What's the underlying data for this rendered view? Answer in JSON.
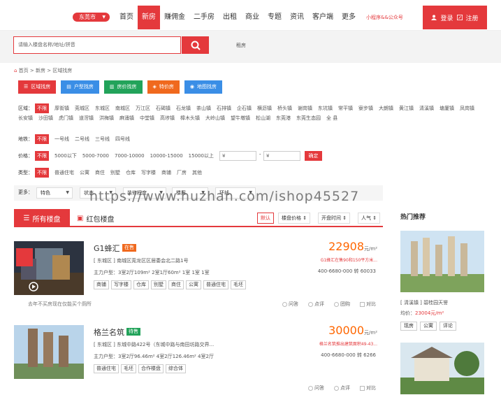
{
  "header": {
    "city": "东莞市",
    "nav": [
      "首页",
      "新房",
      "赚佣金",
      "二手房",
      "出租",
      "商业",
      "专题",
      "资讯",
      "客户端",
      "更多"
    ],
    "active_nav": 1,
    "mini_program": "小程序&&公众号",
    "login": "登录",
    "register": "注册"
  },
  "search": {
    "placeholder": "请输入楼盘名称/地址/拼音",
    "rent": "租房"
  },
  "breadcrumb": "首页 > 新房 > 区域找房",
  "find_tabs": [
    {
      "label": "区域找房",
      "color": "#e4393c"
    },
    {
      "label": "户型找房",
      "color": "#3a8ee6"
    },
    {
      "label": "房价找房",
      "color": "#22a35a"
    },
    {
      "label": "特价房",
      "color": "#f0691e"
    },
    {
      "label": "地图找房",
      "color": "#3a8ee6"
    }
  ],
  "filters": {
    "area_label": "区域：",
    "area_options": [
      "不限",
      "厚街镇",
      "莞城区",
      "东城区",
      "南城区",
      "万江区",
      "石碣镇",
      "石龙镇",
      "茶山镇",
      "石排镇",
      "企石镇",
      "横沥镇",
      "桥头镇",
      "谢岗镇",
      "东坑镇",
      "常平镇",
      "寮步镇",
      "大朗镇",
      "黄江镇",
      "清溪镇",
      "塘厦镇",
      "凤岗镇",
      "长安镇",
      "沙田镇",
      "虎门镇",
      "道滘镇",
      "洪梅镇",
      "麻涌镇",
      "中堂镇",
      "高埗镇",
      "樟木头镇",
      "大岭山镇",
      "望牛墩镇",
      "松山湖",
      "东莞港",
      "东莞生态园",
      "全 县"
    ],
    "metro_label": "地铁：",
    "metro_options": [
      "不限",
      "一号线",
      "二号线",
      "三号线",
      "四号线"
    ],
    "price_label": "价格：",
    "price_options": [
      "不限",
      "5000以下",
      "5000-7000",
      "7000-10000",
      "10000-15000",
      "15000以上"
    ],
    "price_min": "¥",
    "price_max": "¥",
    "price_sep": "-",
    "confirm": "确定",
    "type_label": "类型：",
    "type_options": [
      "不限",
      "普通住宅",
      "公寓",
      "商住",
      "别墅",
      "仓库",
      "写字楼",
      "商铺",
      "厂房",
      "其他"
    ]
  },
  "more": {
    "label": "更多：",
    "dropdowns": [
      "特色",
      "状态",
      "装修程度",
      "楼层",
      "环线"
    ]
  },
  "watermark": "https://www.huzhan.com/ishop45527",
  "list_tabs": {
    "all": "所有楼盘",
    "red": "红包楼盘",
    "sort": [
      "默认",
      "楼盘价格 ⇕",
      "开盘时间 ⇕",
      "人气 ⇕"
    ]
  },
  "listings": [
    {
      "name": "G1蜂汇",
      "status": "在售",
      "status_color": "#f0691e",
      "address": "[ 东城区 ] 南城区莞龙区区居委会北二路1号",
      "types": "主力户型：3室2厅109m²  2室1厅60m²  1室  1室  1室",
      "tags": [
        "商铺",
        "写字楼",
        "仓库",
        "别墅",
        "商住",
        "公寓",
        "普通住宅",
        "毛坯"
      ],
      "price": "22908",
      "unit": "元/m²",
      "promo": "G1蜂汇在售90和150平方米...",
      "phone": "400-6680-000 转 60033",
      "note": "去年不买房现在仅能买个厕所",
      "actions": [
        "问答",
        "点评",
        "团购",
        "对比"
      ]
    },
    {
      "name": "格兰名筑",
      "status": "待售",
      "status_color": "#22a35a",
      "address": "[ 东城区 ] 东城中路422号（东城中路与南田坊路交界...",
      "types": "主力户型：3室2厅96.46m²  4室2厅126.46m²  4室2厅",
      "tags": [
        "普通住宅",
        "毛坯",
        "合作楼盘",
        "综合体"
      ],
      "price": "30000",
      "unit": "元/m²",
      "promo": "格兰名筑推出建筑面积49-43...",
      "phone": "400-6680-000 转 6266",
      "note": "",
      "actions": [
        "问答",
        "点评",
        "对比"
      ]
    }
  ],
  "hot": {
    "title": "热门推荐",
    "name": "[ 清溪镇 ]  碧桂园天誉",
    "price_label": "均价：",
    "price": "23004元/m²",
    "tags": [
      "现房",
      "公寓",
      "评论"
    ]
  }
}
